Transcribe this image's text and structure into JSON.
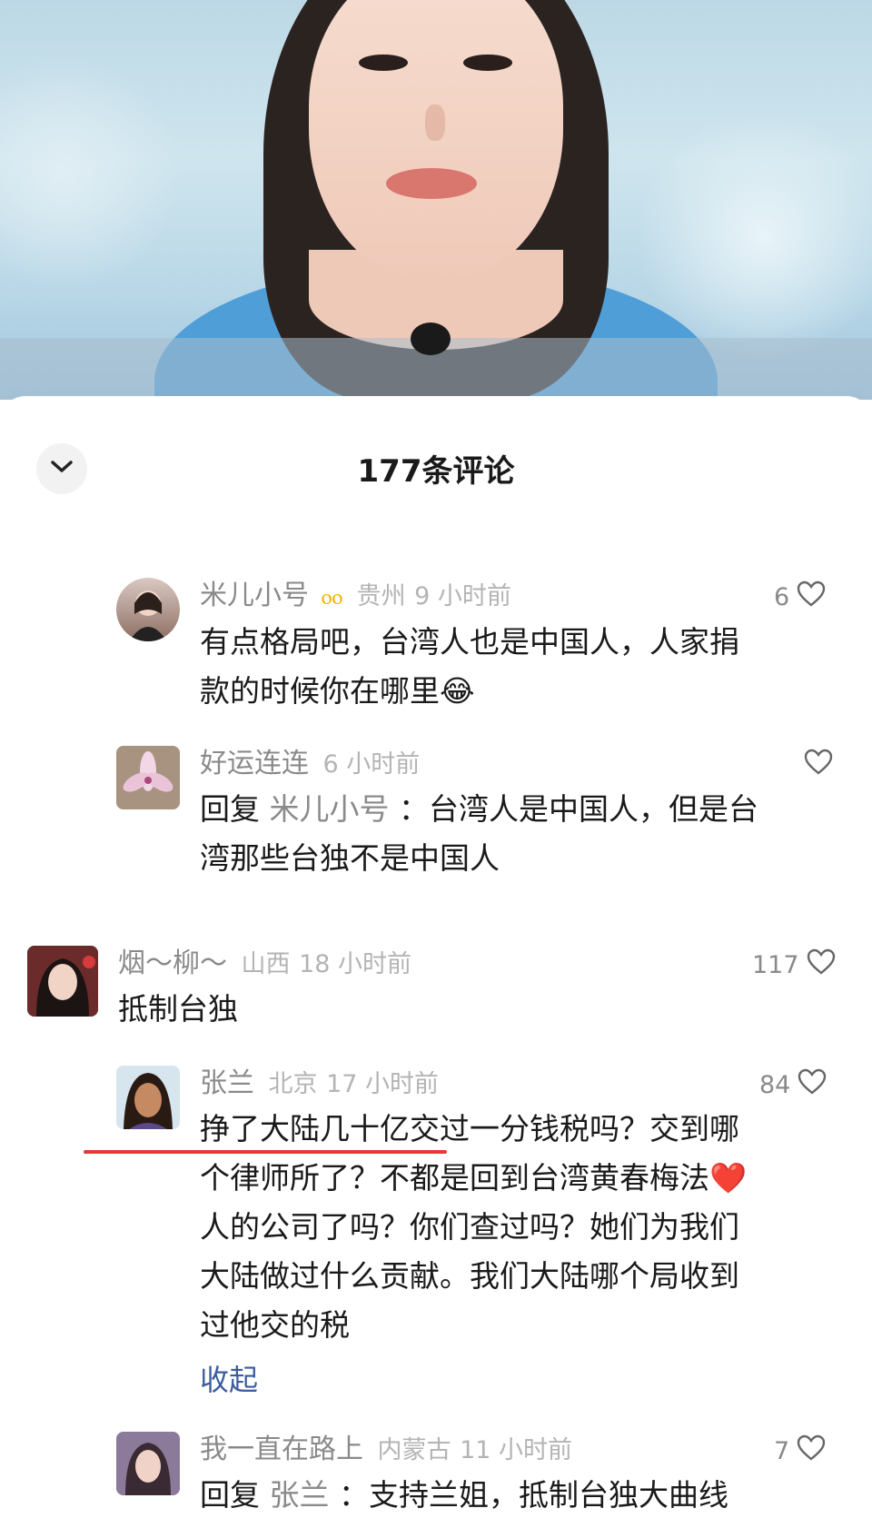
{
  "panel": {
    "title": "177条评论"
  },
  "comments": [
    {
      "username": "米儿小号",
      "badge": "ⲟⲟ",
      "location": "贵州",
      "time": "9 小时前",
      "likes": "6",
      "text_line1": "有点格局吧，台湾人也是中国人，人家捐",
      "text_line2": "款的时候你在哪里😂"
    },
    {
      "username": "好运连连",
      "time": "6 小时前",
      "likes": "",
      "reply_prefix": "回复",
      "reply_to": "米儿小号",
      "text_line1": "：台湾人是中国人，但是台",
      "text_line2": "湾那些台独不是中国人"
    },
    {
      "username": "烟～柳～",
      "location": "山西",
      "time": "18 小时前",
      "likes": "117",
      "text_line1": "抵制台独"
    },
    {
      "username": "张兰",
      "location": "北京",
      "time": "17 小时前",
      "likes": "84",
      "text_line1": "挣了大陆几十亿交过一分钱税吗？交到哪",
      "text_line2": "个律师所了？不都是回到台湾黄春梅法❤️",
      "text_line3": "人的公司了吗？你们查过吗？她们为我们",
      "text_line4": "大陆做过什么贡献。我们大陆哪个局收到",
      "text_line5": "过他交的税",
      "collapse": "收起"
    },
    {
      "username": "我一直在路上",
      "location": "内蒙古",
      "time": "11 小时前",
      "likes": "7",
      "reply_prefix": "回复",
      "reply_to": "张兰",
      "text_line1": "：支持兰姐，抵制台独大曲线"
    }
  ],
  "colors": {
    "username": "#8a8a8a",
    "meta": "#b4b4b4",
    "text": "#1a1a1a",
    "link": "#3b5d9c",
    "highlight_underline": "#e53935"
  }
}
